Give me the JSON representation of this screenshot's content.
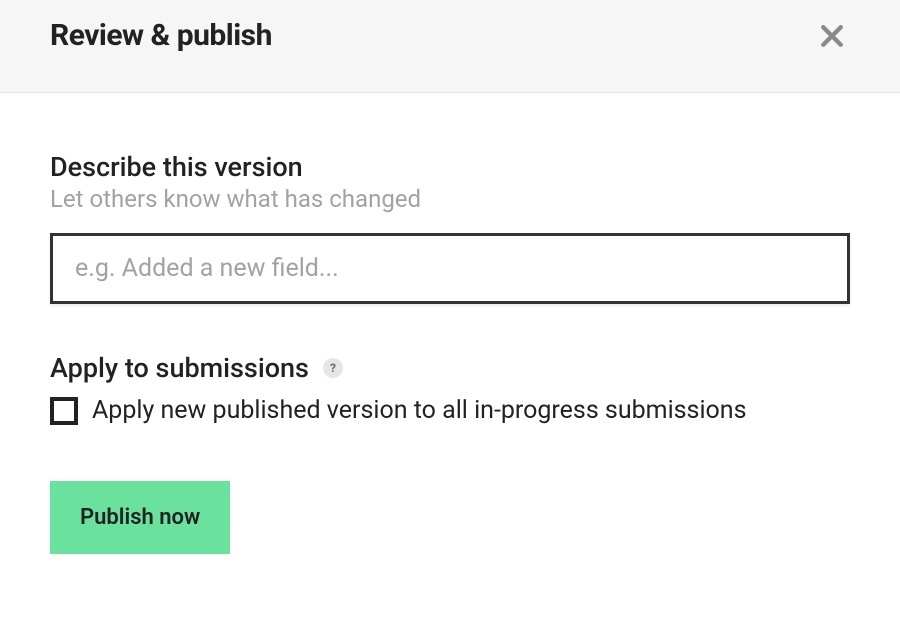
{
  "header": {
    "title": "Review & publish"
  },
  "describe": {
    "title": "Describe this version",
    "subtitle": "Let others know what has changed",
    "placeholder": "e.g. Added a new field...",
    "value": ""
  },
  "apply": {
    "title": "Apply to submissions",
    "help_tooltip": "?",
    "checkbox_label": "Apply new published version to all in-progress submissions",
    "checked": false
  },
  "actions": {
    "publish_label": "Publish now"
  }
}
